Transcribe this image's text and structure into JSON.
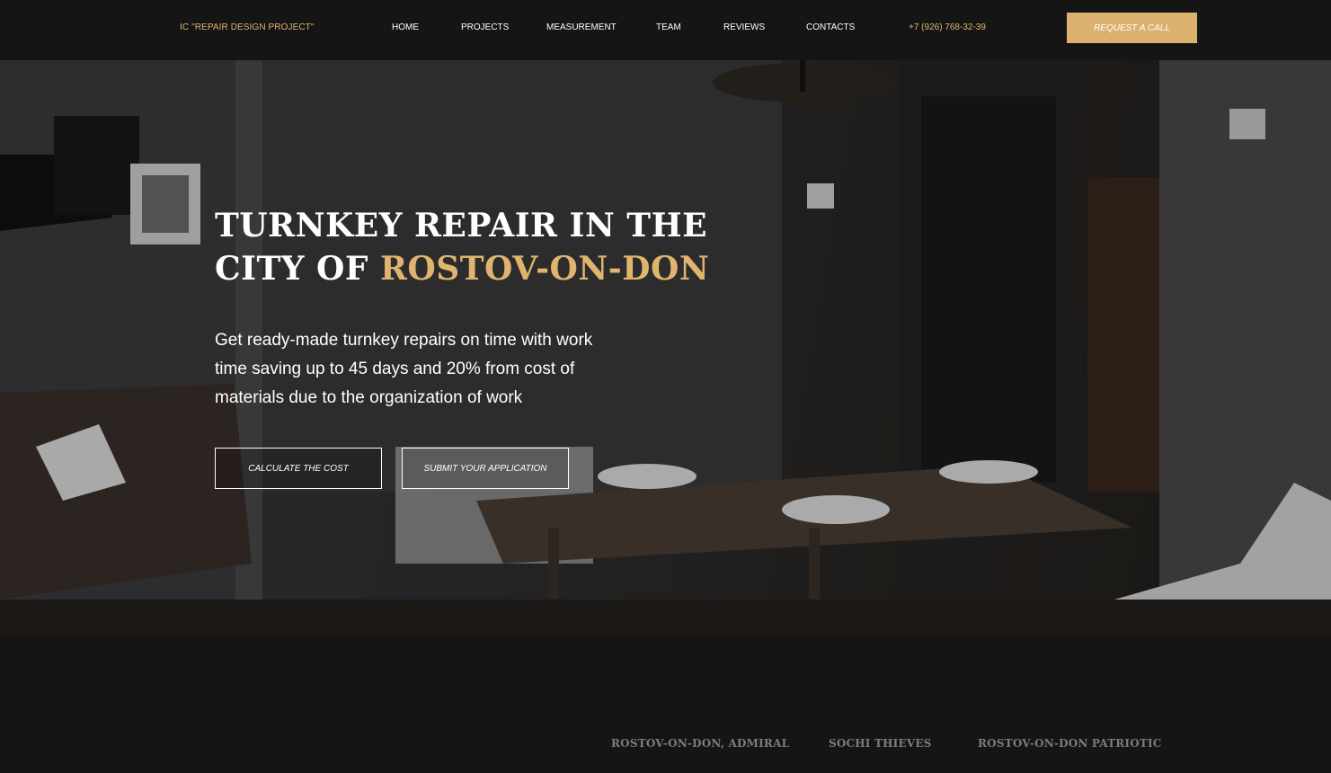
{
  "header": {
    "logo": "IC \"REPAIR DESIGN PROJECT\"",
    "nav": [
      "HOME",
      "PROJECTS",
      "MEASUREMENT",
      "TEAM",
      "REVIEWS",
      "CONTACTS"
    ],
    "phone": "+7 (926) 768-32-39",
    "request_label": "REQUEST A CALL"
  },
  "hero": {
    "title_part1": "TURNKEY REPAIR IN THE",
    "title_part2": "CITY OF",
    "title_accent": "ROSTOV-ON-DON",
    "text": "Get ready-made turnkey repairs on time with work time saving up to 45 days and 20% from cost of materials due to the organization of work",
    "calculate_label": "CALCULATE THE COST",
    "submit_label": "SUBMIT YOUR APPLICATION"
  },
  "projects": {
    "tabs": [
      "ROSTOV-ON-DON, ADMIRAL",
      "SOCHI THIEVES",
      "ROSTOV-ON-DON PATRIOTIC"
    ]
  },
  "colors": {
    "accent": "#e0b46e",
    "button": "#dcb16f",
    "background": "#151515"
  }
}
